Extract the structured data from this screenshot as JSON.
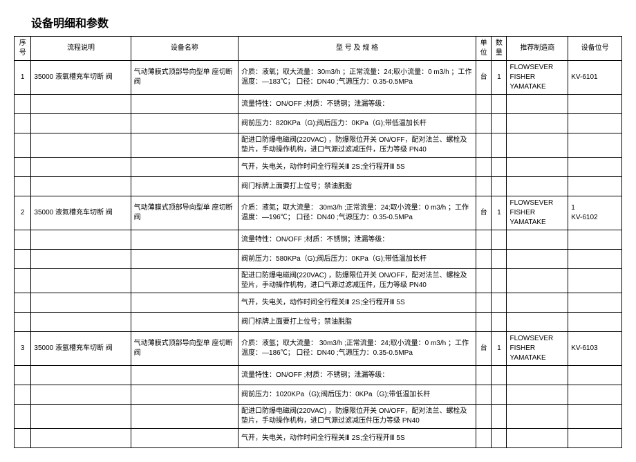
{
  "title": "设备明细和参数",
  "columns": {
    "seq": "序号",
    "proc": "流程说明",
    "name": "设备名称",
    "spec": "型 号 及 规 格",
    "unit": "单位",
    "qty": "数量",
    "mfr": "推荐制造商",
    "pos": "设备位号"
  },
  "rows": [
    {
      "seq": "1",
      "proc": "35000 液氧槽充车切断 阀",
      "name": "气动薄膜式顶部导向型单 座切断阀",
      "spec_main": "介质：液氧；取大流量：30m3/h ；正常流量：24;取小流量：0 m3/h ；工作温度：—183℃； 口径：DN40 ;气源压力：0.35-0.5MPa",
      "unit": "台",
      "qty": "1",
      "mfr": "FLOWSEVER FISHER YAMATAKE",
      "pos": "KV-6101",
      "details": [
        "流量特性：ON/OFF ;材质：不锈钢；泄漏等级：",
        "阀前压力：820KPa（G);阀后压力：0KPa（G);带低温加长杆",
        "配进口防爆电磁阀(220VAC) ，防爆限位开关 ON/OFF，配对法兰、螺栓及垫片，手动操作机构，进口气源过滤减压件，压力等级                                             PN40",
        "气开，失电关，动作时间全行程关Ⅲ      2S;全行程开Ⅲ  5S",
        "阀门标牌上面要打上位号；禁油脱脂"
      ]
    },
    {
      "seq": "2",
      "proc": "35000 液氮槽充车切断 阀",
      "name": "气动薄膜式顶部导向型单 座切断阀",
      "spec_main": "介质：液氮；取大流量：      30m3/h ;正常流量：24;取小流量：0 m3/h ；工作温度：—196℃； 口径：DN40 ;气源压力：0.35-0.5MPa",
      "unit": "台",
      "qty": "1",
      "mfr": "FLOWSEVER FISHER YAMATAKE",
      "pos": "1\nKV-6102",
      "details": [
        "流量特性：ON/OFF ;材质：不锈钢；泄漏等级：",
        "阀前压力：580KPa（G);阀后压力：0KPa（G);带低温加长杆",
        "配进口防爆电磁阀(220VAC) ，防爆限位开关 ON/OFF，配对法兰、螺栓及垫片，手动操作机构，进口气源过滤减压件，压力等级                                             PN40",
        "气开，失电关，动作时间全行程关Ⅲ      2S;全行程开Ⅲ  5S",
        "阀门标牌上面要打上位号；禁油脱脂"
      ]
    },
    {
      "seq": "3",
      "proc": "35000 液氩槽充车切断 阀",
      "name": "气动薄膜式顶部导向型单 座切断阀",
      "spec_main": "介质：液氩；取大流量：      30m3/h ;正常流量：24;取小流量：0 m3/h ；工作温度：—186℃； 口径：DN40 ;气源压力：0.35-0.5MPa",
      "unit": "台",
      "qty": "1",
      "mfr": "FLOWSEVER FISHER YAMATAKE",
      "pos": "KV-6103",
      "details": [
        "流量特性：ON/OFF ;材质：不锈钢；泄漏等级：",
        "阀前压力：1020KPa（G);阀后压力：0KPa（G);带低温加长杆",
        "配进口防爆电磁阀(220VAC) ，防爆限位开关 ON/OFF，配对法兰、螺栓及垫片，手动操作机构，进口气源过滤减压件压力等级                                             PN40",
        "气开，失电关，动作时间全行程关Ⅲ      2S;全行程开Ⅲ  5S"
      ]
    }
  ]
}
